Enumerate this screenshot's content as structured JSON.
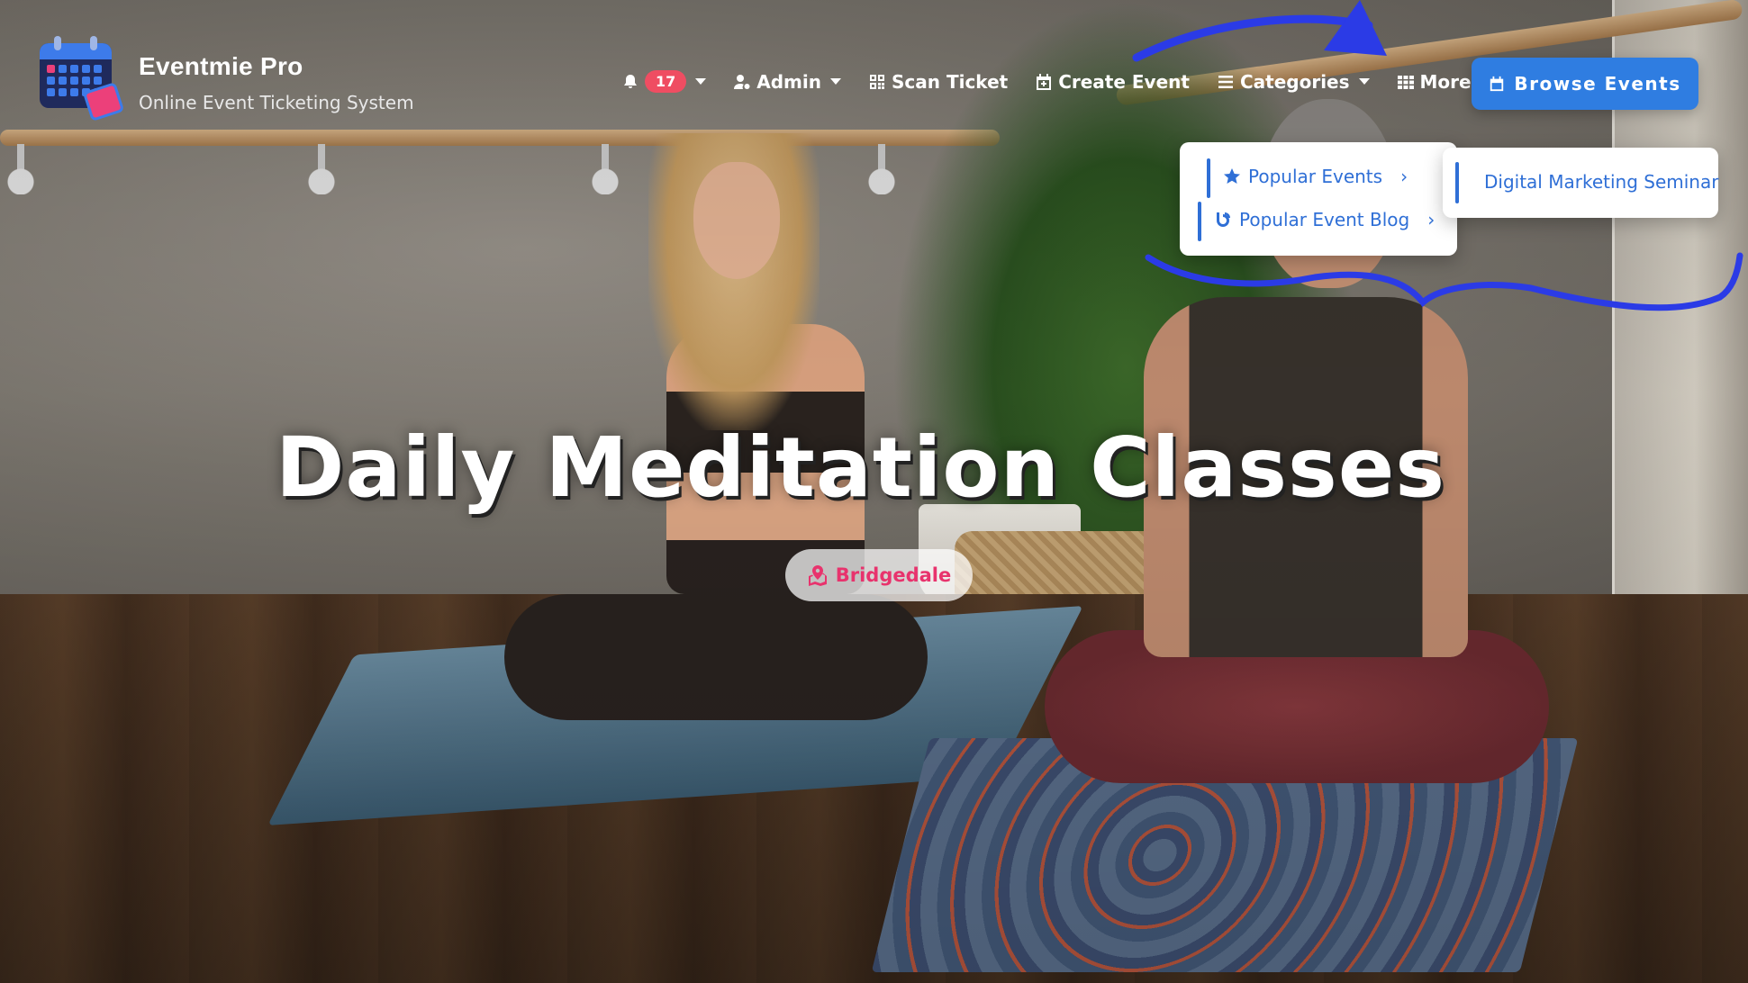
{
  "brand": {
    "name": "Eventmie Pro",
    "tagline": "Online Event Ticketing System"
  },
  "nav": {
    "notification_count": "17",
    "admin_label": "Admin",
    "scan_ticket_label": "Scan Ticket",
    "create_event_label": "Create Event",
    "categories_label": "Categories",
    "more_label": "More",
    "browse_events_label": "Browse Events"
  },
  "more_dropdown": {
    "items": [
      {
        "label": "Popular Events",
        "icon": "star-icon"
      },
      {
        "label": "Popular Event Blog",
        "icon": "blog-icon"
      }
    ],
    "submenu": {
      "items": [
        {
          "label": "Digital Marketing Seminar"
        }
      ]
    }
  },
  "hero": {
    "title": "Daily Meditation Classes",
    "location": "Bridgedale"
  },
  "colors": {
    "primary": "#2f7de1",
    "badge": "#ef4d62",
    "location": "#e8336d",
    "annotation": "#2b3be6"
  }
}
